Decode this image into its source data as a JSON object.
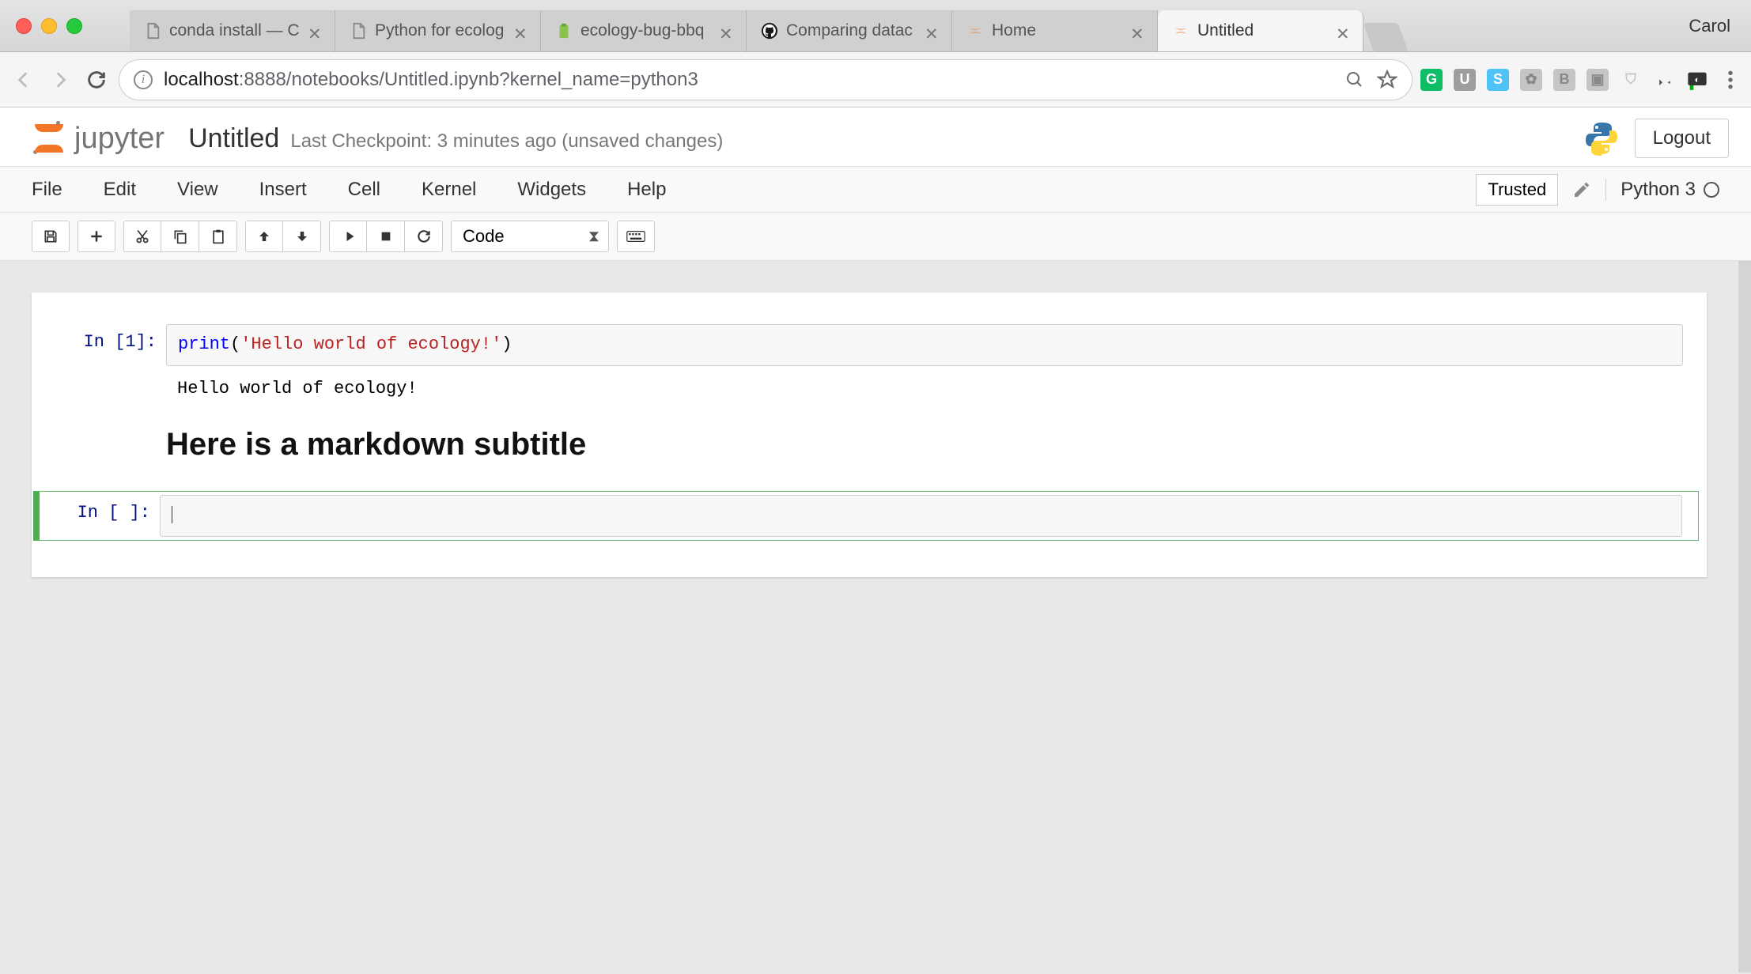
{
  "browser": {
    "profile": "Carol",
    "tabs": [
      {
        "title": "conda install — C",
        "icon": "file-icon",
        "active": false
      },
      {
        "title": "Python for ecolog",
        "icon": "file-icon",
        "active": false
      },
      {
        "title": "ecology-bug-bbq",
        "icon": "clipboard-icon",
        "active": false
      },
      {
        "title": "Comparing datac",
        "icon": "github-icon",
        "active": false
      },
      {
        "title": "Home",
        "icon": "jupyter-icon",
        "active": false
      },
      {
        "title": "Untitled",
        "icon": "jupyter-icon",
        "active": true
      }
    ],
    "url_host": "localhost",
    "url_port": ":8888",
    "url_path": "/notebooks/Untitled.ipynb?kernel_name=python3"
  },
  "jupyter": {
    "brand": "jupyter",
    "notebook_title": "Untitled",
    "checkpoint": "Last Checkpoint: 3 minutes ago (unsaved changes)",
    "logout": "Logout",
    "menu": [
      "File",
      "Edit",
      "View",
      "Insert",
      "Cell",
      "Kernel",
      "Widgets",
      "Help"
    ],
    "trusted": "Trusted",
    "kernel_name": "Python 3",
    "celltype_selected": "Code"
  },
  "cells": {
    "c1_prompt": "In [1]:",
    "c1_code_fn": "print",
    "c1_code_open": "(",
    "c1_code_str": "'Hello world of ecology!'",
    "c1_code_close": ")",
    "c1_output": "Hello world of ecology!",
    "md_heading": "Here is a markdown subtitle",
    "c2_prompt": "In [ ]:"
  }
}
